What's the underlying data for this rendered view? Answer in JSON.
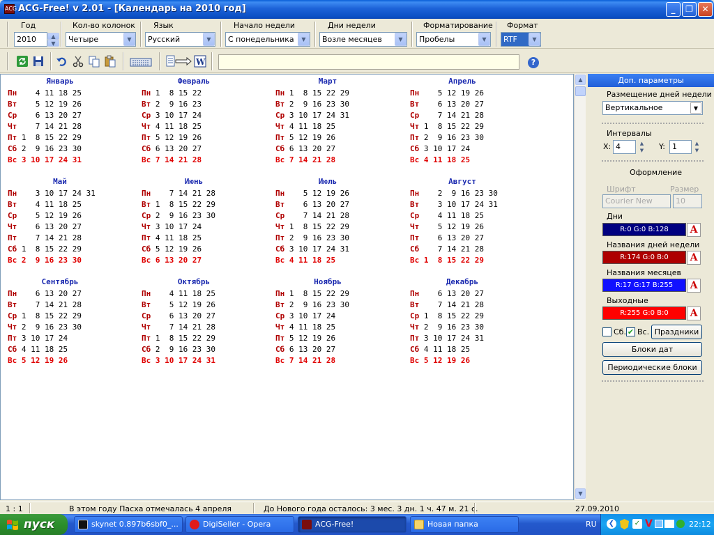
{
  "window": {
    "title": "ACG-Free! v 2.01 - [Календарь на 2010 год]",
    "icon_text": "ACG"
  },
  "options": {
    "year": {
      "label": "Год",
      "value": "2010"
    },
    "columns": {
      "label": "Кол-во колонок",
      "value": "Четыре"
    },
    "language": {
      "label": "Язык",
      "value": "Русский"
    },
    "week_start": {
      "label": "Начало недели",
      "value": "С понедельника"
    },
    "weekdays": {
      "label": "Дни недели",
      "value": "Возле месяцев"
    },
    "formatting": {
      "label": "Форматирование",
      "value": "Пробелы"
    },
    "format": {
      "label": "Формат",
      "value": "RTF"
    }
  },
  "toolbar": {
    "icons": [
      "refresh-icon",
      "save-icon",
      "undo-icon",
      "cut-icon",
      "copy-icon",
      "paste-icon",
      "keyboard-icon",
      "export-icon",
      "word-icon"
    ],
    "hint": "",
    "help": "?"
  },
  "day_labels": [
    "Пн",
    "Вт",
    "Ср",
    "Чт",
    "Пт",
    "Сб",
    "Вс"
  ],
  "months": [
    {
      "name": "Январь",
      "rows": [
        "    4 11 18 25",
        "    5 12 19 26",
        "    6 13 20 27",
        "    7 14 21 28",
        " 1  8 15 22 29",
        " 2  9 16 23 30",
        " 3 10 17 24 31"
      ]
    },
    {
      "name": "Февраль",
      "rows": [
        " 1  8 15 22",
        " 2  9 16 23",
        " 3 10 17 24",
        " 4 11 18 25",
        " 5 12 19 26",
        " 6 13 20 27",
        " 7 14 21 28"
      ]
    },
    {
      "name": "Март",
      "rows": [
        " 1  8 15 22 29",
        " 2  9 16 23 30",
        " 3 10 17 24 31",
        " 4 11 18 25",
        " 5 12 19 26",
        " 6 13 20 27",
        " 7 14 21 28"
      ]
    },
    {
      "name": "Апрель",
      "rows": [
        "    5 12 19 26",
        "    6 13 20 27",
        "    7 14 21 28",
        " 1  8 15 22 29",
        " 2  9 16 23 30",
        " 3 10 17 24",
        " 4 11 18 25"
      ]
    },
    {
      "name": "Май",
      "rows": [
        "    3 10 17 24 31",
        "    4 11 18 25",
        "    5 12 19 26",
        "    6 13 20 27",
        "    7 14 21 28",
        " 1  8 15 22 29",
        " 2  9 16 23 30"
      ]
    },
    {
      "name": "Июнь",
      "rows": [
        "    7 14 21 28",
        " 1  8 15 22 29",
        " 2  9 16 23 30",
        " 3 10 17 24",
        " 4 11 18 25",
        " 5 12 19 26",
        " 6 13 20 27"
      ]
    },
    {
      "name": "Июль",
      "rows": [
        "    5 12 19 26",
        "    6 13 20 27",
        "    7 14 21 28",
        " 1  8 15 22 29",
        " 2  9 16 23 30",
        " 3 10 17 24 31",
        " 4 11 18 25"
      ]
    },
    {
      "name": "Август",
      "rows": [
        "    2  9 16 23 30",
        "    3 10 17 24 31",
        "    4 11 18 25",
        "    5 12 19 26",
        "    6 13 20 27",
        "    7 14 21 28",
        " 1  8 15 22 29"
      ]
    },
    {
      "name": "Сентябрь",
      "rows": [
        "    6 13 20 27",
        "    7 14 21 28",
        " 1  8 15 22 29",
        " 2  9 16 23 30",
        " 3 10 17 24",
        " 4 11 18 25",
        " 5 12 19 26"
      ]
    },
    {
      "name": "Октябрь",
      "rows": [
        "    4 11 18 25",
        "    5 12 19 26",
        "    6 13 20 27",
        "    7 14 21 28",
        " 1  8 15 22 29",
        " 2  9 16 23 30",
        " 3 10 17 24 31"
      ]
    },
    {
      "name": "Ноябрь",
      "rows": [
        " 1  8 15 22 29",
        " 2  9 16 23 30",
        " 3 10 17 24",
        " 4 11 18 25",
        " 5 12 19 26",
        " 6 13 20 27",
        " 7 14 21 28"
      ]
    },
    {
      "name": "Декабрь",
      "rows": [
        "    6 13 20 27",
        "    7 14 21 28",
        " 1  8 15 22 29",
        " 2  9 16 23 30",
        " 3 10 17 24 31",
        " 4 11 18 25",
        " 5 12 19 26"
      ]
    }
  ],
  "panel": {
    "title": "Доп. параметры",
    "day_placement_label": "Размещение дней недели",
    "day_placement_value": "Вертикальное",
    "intervals_label": "Интервалы",
    "x_label": "X:",
    "x_value": "4",
    "y_label": "Y:",
    "y_value": "1",
    "design_label": "Оформление",
    "font_label": "Шрифт",
    "size_label": "Размер",
    "font_value": "Courier New",
    "size_value": "10",
    "days_label": "Дни",
    "days_color": "R:0 G:0 B:128",
    "days_hex": "#000080",
    "weekday_names_label": "Названия дней недели",
    "weekday_names_color": "R:174 G:0 B:0",
    "weekday_names_hex": "#ae0000",
    "month_names_label": "Названия месяцев",
    "month_names_color": "R:17 G:17 B:255",
    "month_names_hex": "#1111ff",
    "weekends_label": "Выходные",
    "weekends_color": "R:255 G:0 B:0",
    "weekends_hex": "#ff0000",
    "font_glyph": "A",
    "sat_label": "Сб.",
    "sun_label": "Вс.",
    "sat_checked": false,
    "sun_checked": true,
    "holidays_button": "Праздники",
    "date_blocks_button": "Блоки дат",
    "periodic_blocks_button": "Периодические блоки"
  },
  "status": {
    "position": "1 :   1",
    "easter": "В этом году Пасха отмечалась 4 апреля",
    "countdown": "До Нового года осталось:  3 мес. 3 дн. 1 ч. 47 м. 21 с.",
    "date": "27.09.2010"
  },
  "taskbar": {
    "start": "пуск",
    "tasks": [
      {
        "label": "skynet 0.897b6sbf0_...",
        "icon": "terminal-icon"
      },
      {
        "label": "DigiSeller - Opera",
        "icon": "opera-icon"
      },
      {
        "label": "ACG-Free!",
        "icon": "app-icon"
      },
      {
        "label": "Новая папка",
        "icon": "folder-icon"
      }
    ],
    "lang": "RU",
    "clock": "22:12"
  }
}
